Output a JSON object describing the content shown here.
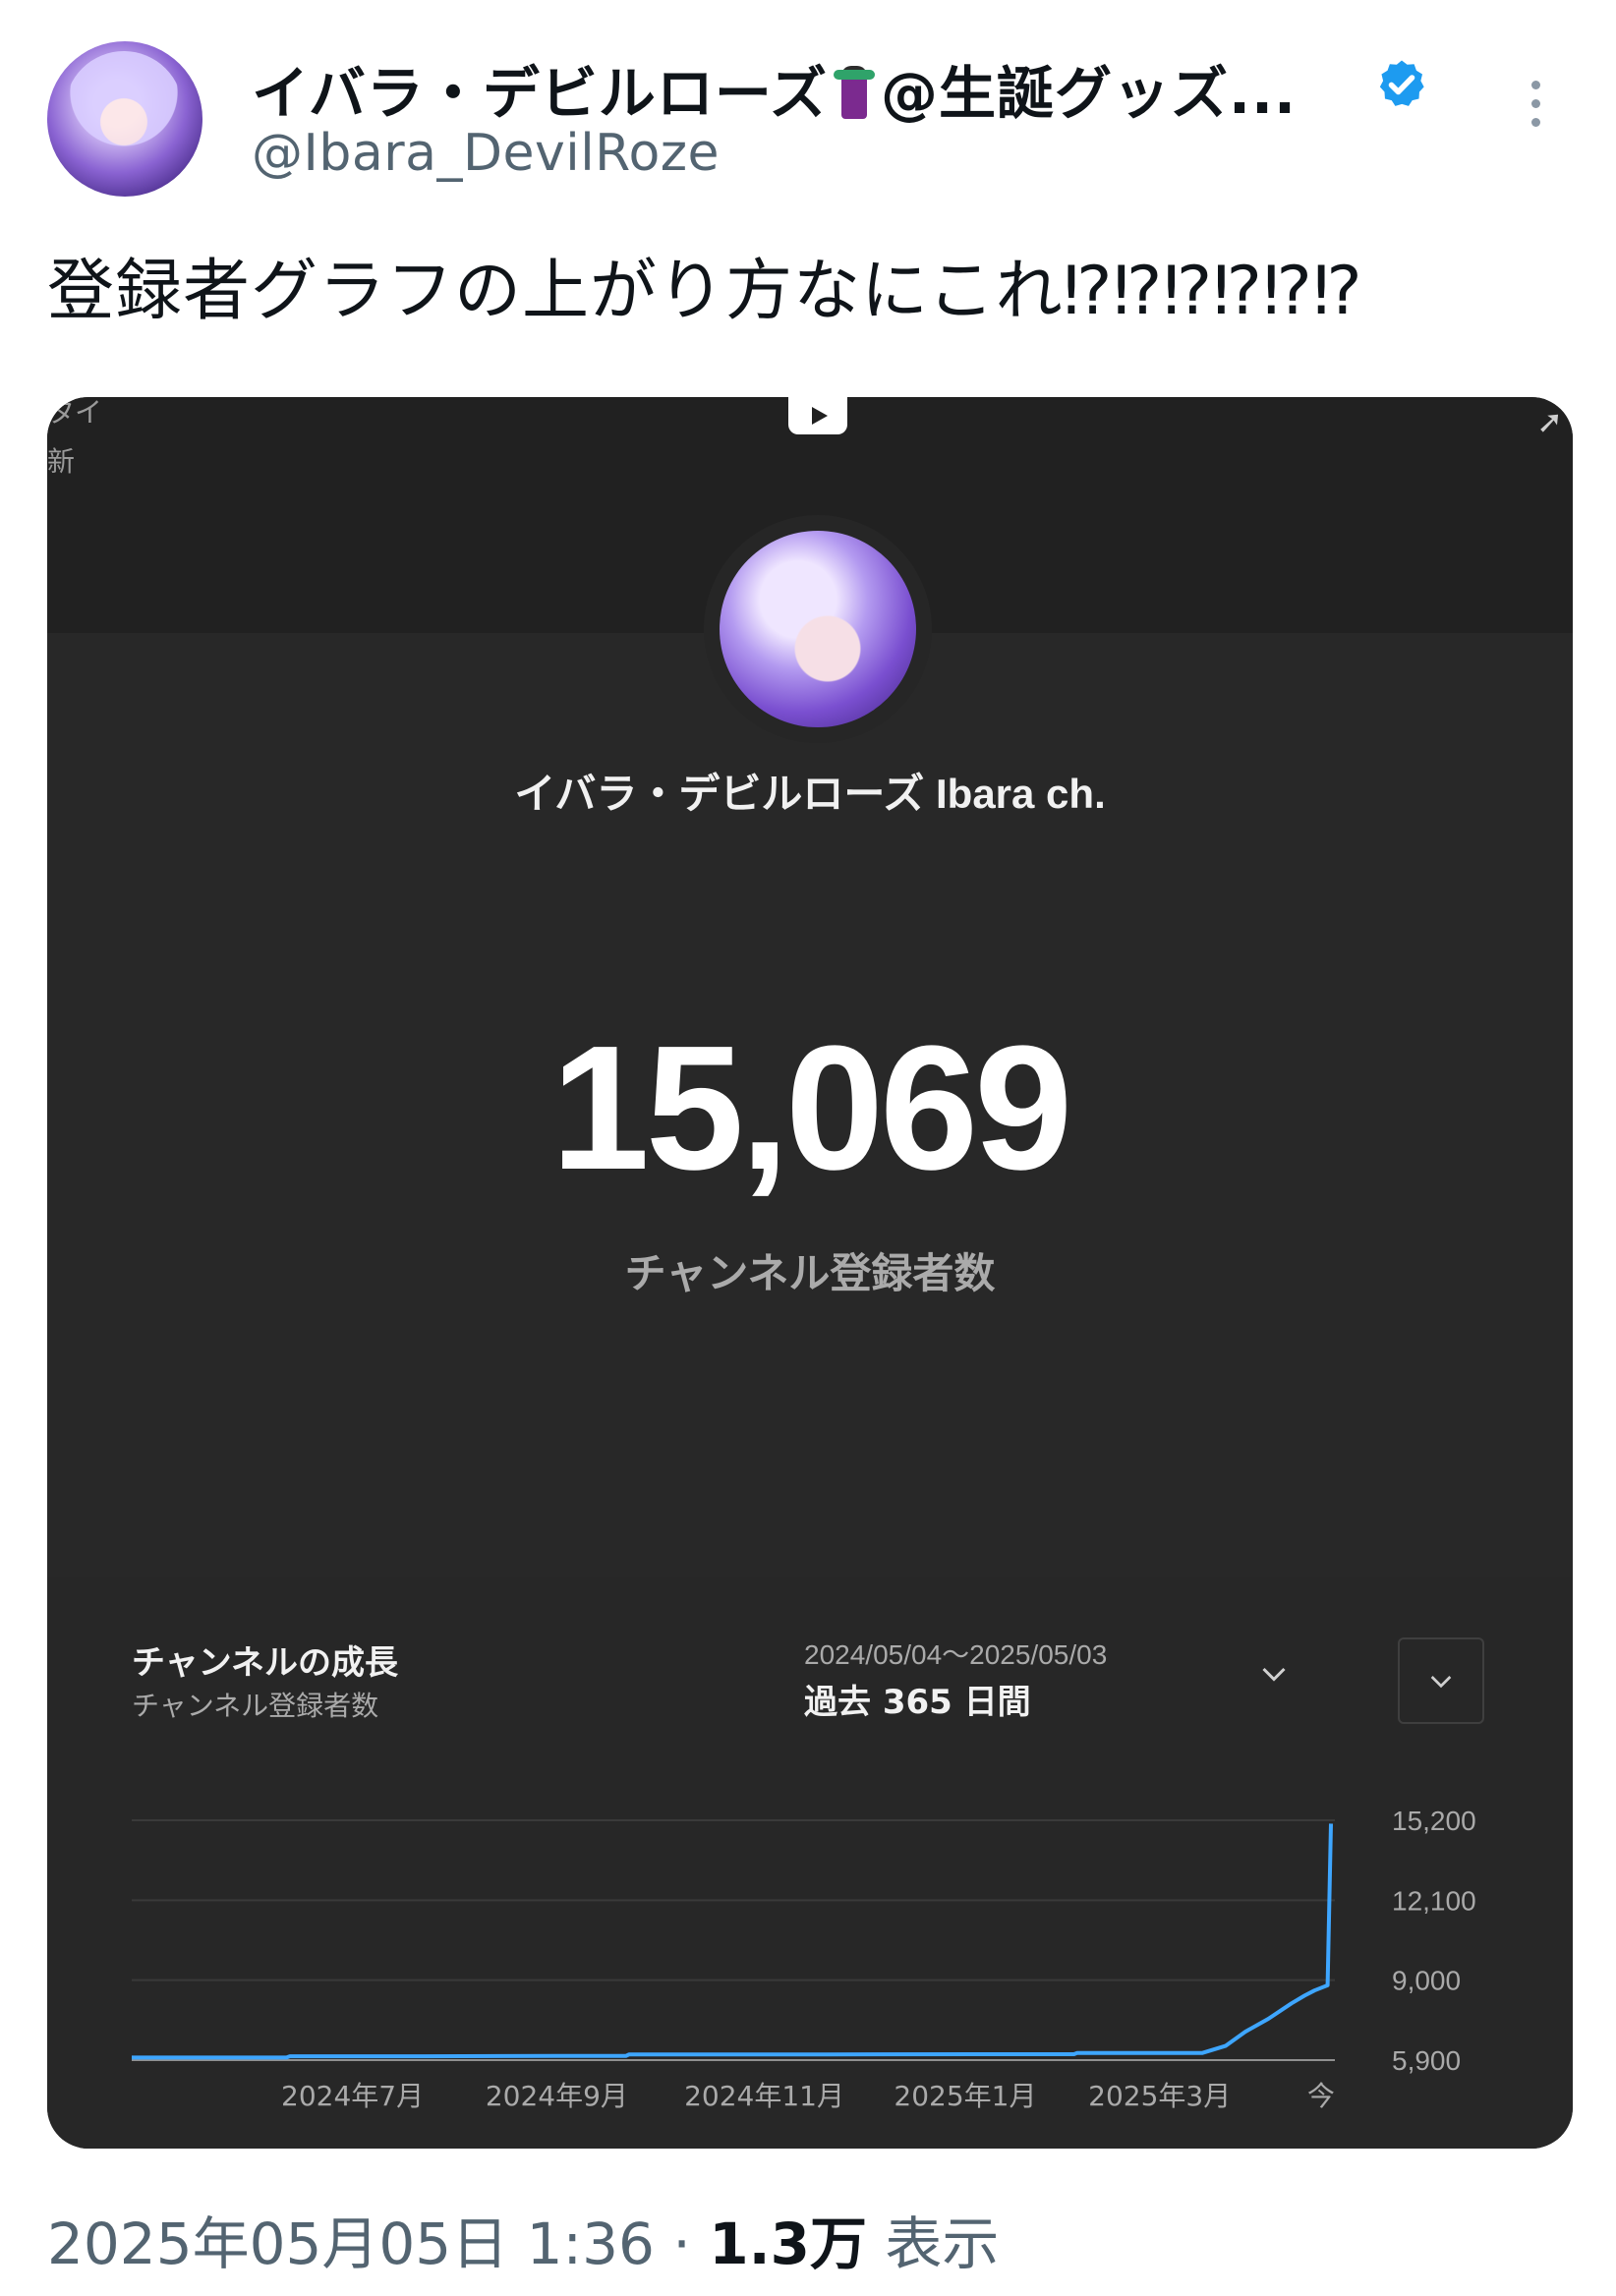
{
  "tweet": {
    "display_name": "イバラ・デビルローズ",
    "display_name_suffix": "@生誕グッズ...",
    "handle": "@Ibara_DevilRoze",
    "text": "登録者グラフの上がり方なにこれ⁉⁉⁉⁉⁉⁉",
    "timestamp": "2025年05月05日 1:36",
    "separator": " · ",
    "views_count": "1.3万",
    "views_label": "表示",
    "colors": {
      "verified": "#1d9bf0",
      "handle": "#536471"
    }
  },
  "screenshot": {
    "corner_text_top": "タイ",
    "corner_text_bottom": "新",
    "channel_name": "イバラ・デビルローズ Ibara ch.",
    "subscriber_count": "15,069",
    "subscriber_label": "チャンネル登録者数",
    "growth": {
      "title": "チャンネルの成長",
      "subtitle": "チャンネル登録者数",
      "date_range": "2024/05/04〜2025/05/03",
      "range_label": "過去 365 日間"
    }
  },
  "chart_data": {
    "type": "line",
    "title": "チャンネルの成長",
    "subtitle": "チャンネル登録者数",
    "x_tick_labels": [
      "2024年7月",
      "2024年9月",
      "2024年11月",
      "2025年1月",
      "2025年3月",
      "今"
    ],
    "y_tick_labels": [
      "15,200",
      "12,100",
      "9,000",
      "5,900"
    ],
    "ylim": [
      5900,
      15200
    ],
    "series_color": "#3ea6ff",
    "grid": true,
    "series": [
      {
        "x": [
          "2024-05-04",
          "2024-06-20",
          "2024-06-21",
          "2024-08-01",
          "2024-09-10",
          "2024-10-01",
          "2024-10-02",
          "2024-12-01",
          "2025-01-15",
          "2025-02-14",
          "2025-02-15",
          "2025-03-25",
          "2025-04-01",
          "2025-04-07",
          "2025-04-14",
          "2025-04-21",
          "2025-04-25",
          "2025-04-28",
          "2025-05-01",
          "2025-05-02",
          "2025-05-03"
        ],
        "values": [
          6000,
          6000,
          6050,
          6050,
          6060,
          6060,
          6120,
          6120,
          6130,
          6130,
          6180,
          6180,
          6450,
          7000,
          7500,
          8100,
          8400,
          8600,
          8750,
          8800,
          15069
        ]
      }
    ]
  }
}
